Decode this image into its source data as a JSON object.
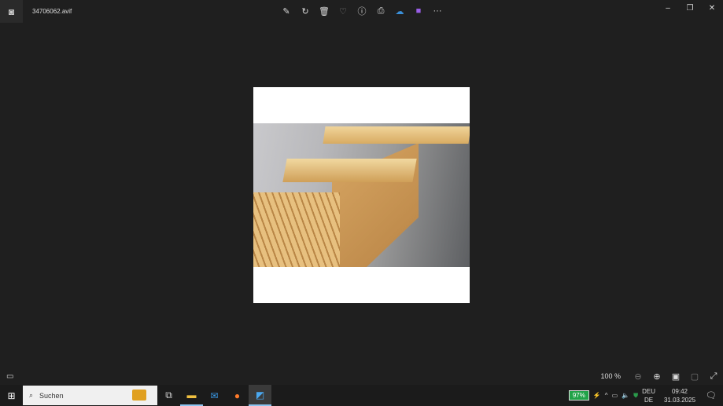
{
  "titlebar": {
    "filename": "34706062.avif",
    "tools": [
      {
        "icon": "edit-icon",
        "glyph": "✎"
      },
      {
        "icon": "rotate-icon",
        "glyph": "↻"
      },
      {
        "icon": "delete-icon",
        "glyph": "🗑"
      },
      {
        "icon": "favorite-icon",
        "glyph": "♡"
      },
      {
        "icon": "info-icon",
        "glyph": "ⓘ"
      },
      {
        "icon": "print-icon",
        "glyph": "⎙"
      },
      {
        "icon": "onedrive-icon",
        "glyph": "☁"
      },
      {
        "icon": "clipchamp-icon",
        "glyph": "■"
      },
      {
        "icon": "more-icon",
        "glyph": "···"
      }
    ],
    "window": {
      "minimize": "–",
      "restore": "❐",
      "close": "✕"
    }
  },
  "bottombar": {
    "zoom": "100 %"
  },
  "taskbar": {
    "search_placeholder": "Suchen",
    "battery": "97%",
    "lang_top": "DEU",
    "lang_bottom": "DE",
    "time": "09:42",
    "date": "31.03.2025"
  },
  "colors": {
    "battery": "#21a348",
    "background": "#1f1f1f"
  }
}
